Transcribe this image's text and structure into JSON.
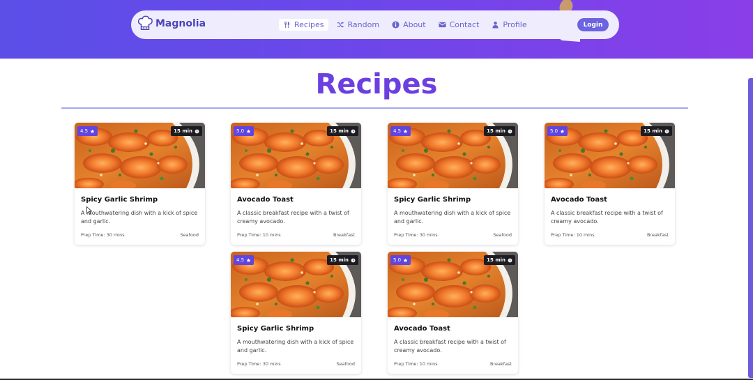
{
  "brand": {
    "name": "Magnolia",
    "icon": "chef-hat-icon"
  },
  "nav": [
    {
      "label": "Recipes",
      "icon": "utensils-icon",
      "active": true
    },
    {
      "label": "Random",
      "icon": "shuffle-icon"
    },
    {
      "label": "About",
      "icon": "info-icon"
    },
    {
      "label": "Contact",
      "icon": "envelope-icon"
    },
    {
      "label": "Profile",
      "icon": "user-icon"
    }
  ],
  "login_label": "Login",
  "page_title": "Recipes",
  "colors": {
    "accent": "#6b3fe0",
    "nav_text": "#6a63cf",
    "rating_badge": "#6045e0",
    "time_badge": "#1c1c22"
  },
  "cards": [
    {
      "rating": "4.5",
      "time": "15 min",
      "title": "Spicy Garlic Shrimp",
      "desc": "A mouthwatering dish with a kick of spice and garlic.",
      "prep": "Prep Time: 30 mins",
      "category": "Seafood"
    },
    {
      "rating": "5.0",
      "time": "15 min",
      "title": "Avocado Toast",
      "desc": "A classic breakfast recipe with a twist of creamy avocado.",
      "prep": "Prep Time: 10 mins",
      "category": "Breakfast"
    },
    {
      "rating": "4.5",
      "time": "15 min",
      "title": "Spicy Garlic Shrimp",
      "desc": "A mouthwatering dish with a kick of spice and garlic.",
      "prep": "Prep Time: 30 mins",
      "category": "Seafood"
    },
    {
      "rating": "5.0",
      "time": "15 min",
      "title": "Avocado Toast",
      "desc": "A classic breakfast recipe with a twist of creamy avocado.",
      "prep": "Prep Time: 10 mins",
      "category": "Breakfast"
    },
    {
      "rating": "4.5",
      "time": "15 min",
      "title": "Spicy Garlic Shrimp",
      "desc": "A mouthwatering dish with a kick of spice and garlic.",
      "prep": "Prep Time: 30 mins",
      "category": "Seafood"
    },
    {
      "rating": "5.0",
      "time": "15 min",
      "title": "Avocado Toast",
      "desc": "A classic breakfast recipe with a twist of creamy avocado.",
      "prep": "Prep Time: 10 mins",
      "category": "Breakfast"
    }
  ]
}
